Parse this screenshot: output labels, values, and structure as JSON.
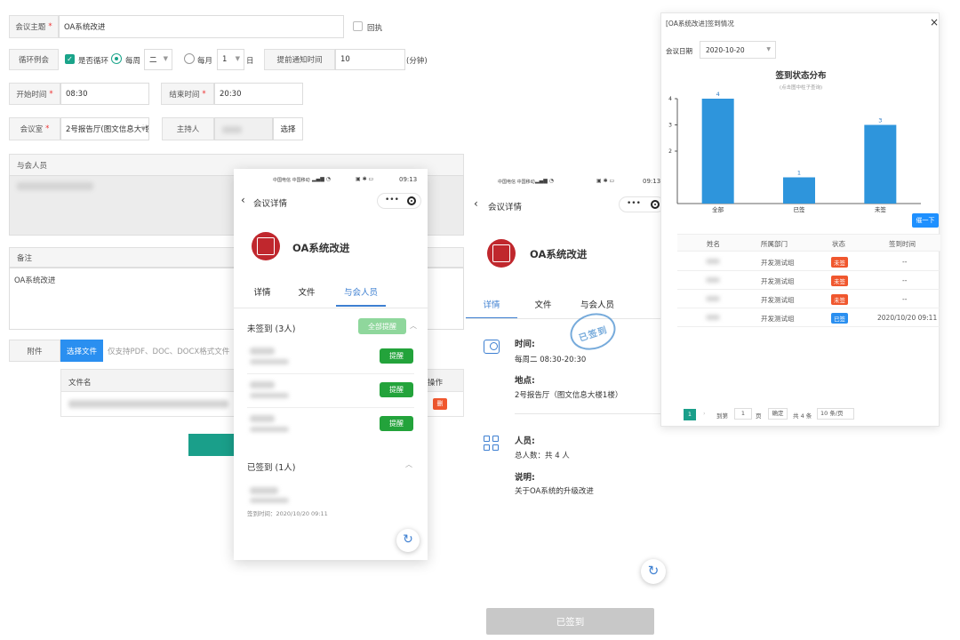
{
  "form": {
    "topic_label": "会议主题",
    "topic_value": "OA系统改进",
    "receipt_label": "回执",
    "recurring_label": "循环例会",
    "is_recurring_label": "是否循环",
    "weekly_label": "每周",
    "weekly_value": "二",
    "monthly_label": "每月",
    "monthly_value": "1",
    "day_label": "日",
    "notify_label": "提前通知时间",
    "notify_value": "10",
    "notify_unit": "(分钟)",
    "start_label": "开始时间",
    "start_value": "08:30",
    "end_label": "结束时间",
    "end_value": "20:30",
    "room_label": "会议室",
    "room_value": "2号报告厅(图文信息大楼",
    "host_label": "主持人",
    "select_label": "选择",
    "attendees_label": "与会人员",
    "notes_label": "备注",
    "notes_value": "OA系统改进",
    "attachment_label": "附件",
    "choose_file_label": "选择文件",
    "file_hint": "仅支持PDF、DOC、DOCX格式文件",
    "filename_header": "文件名",
    "action_header": "操作",
    "delete_label": "删"
  },
  "phone1": {
    "status_carrier": "中国电信 中国移动",
    "status_time": "09:13",
    "nav_title": "会议详情",
    "meeting_title": "OA系统改进",
    "tabs": [
      "详情",
      "文件",
      "与会人员"
    ],
    "active_tab": 2,
    "unsigned_title": "未签到 (3人)",
    "remind_all_label": "全部提醒",
    "remind_label": "提醒",
    "signed_title": "已签到 (1人)",
    "signed_time": "签到时间：2020/10/20 09:11"
  },
  "phone2": {
    "status_carrier": "中国电信 中国移动",
    "status_time": "09:13",
    "nav_title": "会议详情",
    "meeting_title": "OA系统改进",
    "tabs": [
      "详情",
      "文件",
      "与会人员"
    ],
    "active_tab": 0,
    "stamp_text": "已签到",
    "time_label": "时间:",
    "time_value": "每周二 08:30-20:30",
    "place_label": "地点:",
    "place_value": "2号报告厅（图文信息大楼1楼）",
    "people_label": "人员:",
    "people_value": "总人数：共 4 人",
    "desc_label": "说明:",
    "desc_value": "关于OA系统的升级改进",
    "signed_button": "已签到"
  },
  "dialog": {
    "title": "[OA系统改进]签到情况",
    "close": "×",
    "date_label": "会议日期",
    "date_value": "2020-10-20",
    "remind_button": "催一下",
    "table_headers": [
      "姓名",
      "所属部门",
      "状态",
      "签到时间"
    ],
    "rows": [
      {
        "dept": "开发测试组",
        "status": "未签",
        "time": "--"
      },
      {
        "dept": "开发测试组",
        "status": "未签",
        "time": "--"
      },
      {
        "dept": "开发测试组",
        "status": "未签",
        "time": "--"
      },
      {
        "dept": "开发测试组",
        "status": "已签",
        "time": "2020/10/20 09:11"
      }
    ],
    "pager": {
      "current": "1",
      "goto_label": "到第",
      "goto_value": "1",
      "page_label": "页",
      "confirm": "确定",
      "total": "共 4 条",
      "per_page": "10 条/页"
    },
    "colors": {
      "unsigned": "#f0572e",
      "signed": "#2a8ff0",
      "bar": "#2e95dc",
      "primary": "#1e90ff"
    }
  },
  "chart_data": {
    "type": "bar",
    "title": "签到状态分布",
    "subtitle": "(点击图中柱子查询)",
    "categories": [
      "全部",
      "已签",
      "未签"
    ],
    "values": [
      4,
      1,
      3
    ],
    "ylim": [
      0,
      4
    ],
    "yticks": [
      2,
      3,
      4
    ]
  }
}
